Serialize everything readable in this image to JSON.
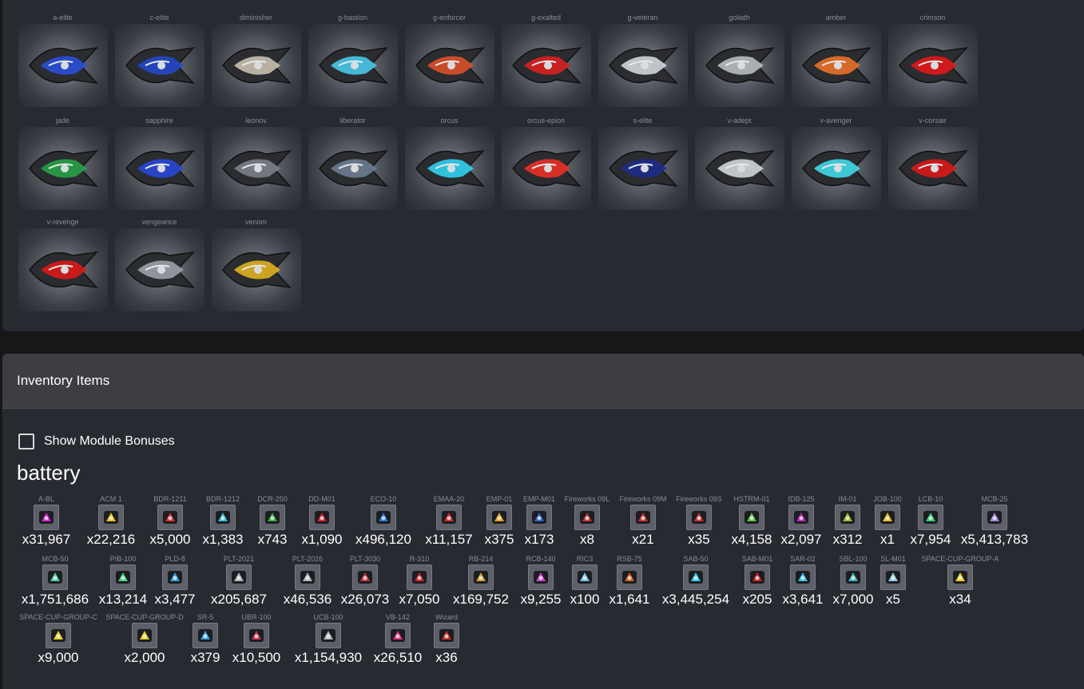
{
  "ships": {
    "rows": [
      [
        {
          "name": "a-elite",
          "color": "#2a4fd8"
        },
        {
          "name": "c-elite",
          "color": "#2248c8"
        },
        {
          "name": "diminisher",
          "color": "#c8c0b0"
        },
        {
          "name": "g-bastion",
          "color": "#47c8e8"
        },
        {
          "name": "g-enforcer",
          "color": "#d8502a"
        },
        {
          "name": "g-exalted",
          "color": "#d82020"
        },
        {
          "name": "g-veteran",
          "color": "#d0d4d8"
        },
        {
          "name": "goliath",
          "color": "#b8bcc0"
        },
        {
          "name": "amber",
          "color": "#e8702a"
        },
        {
          "name": "crimson",
          "color": "#e01818"
        }
      ],
      [
        {
          "name": "jade",
          "color": "#28a048"
        },
        {
          "name": "sapphire",
          "color": "#2848d8"
        },
        {
          "name": "leonov",
          "color": "#7c8088"
        },
        {
          "name": "liberator",
          "color": "#6c7c90"
        },
        {
          "name": "orcus",
          "color": "#30d0f0"
        },
        {
          "name": "orcus-epion",
          "color": "#e83028"
        },
        {
          "name": "s-elite",
          "color": "#1c2c88"
        },
        {
          "name": "v-adept",
          "color": "#d0d4d8"
        },
        {
          "name": "v-avenger",
          "color": "#40d8e8"
        },
        {
          "name": "v-corsair",
          "color": "#d81818"
        }
      ],
      [
        {
          "name": "v-revenge",
          "color": "#d81818"
        },
        {
          "name": "vengeance",
          "color": "#9ca0a8"
        },
        {
          "name": "venom",
          "color": "#e0b020"
        }
      ]
    ]
  },
  "inventory": {
    "title": "Inventory Items",
    "show_bonuses_label": "Show Module Bonuses",
    "category": "battery",
    "rows": [
      [
        {
          "label": "A-BL",
          "count": "x31,967",
          "color": "#d820d8",
          "w": 78
        },
        {
          "label": "ACM 1",
          "count": "x22,216",
          "color": "#e8c020",
          "w": 80
        },
        {
          "label": "BDR-1211",
          "count": "x5,000",
          "color": "#d83030",
          "w": 64
        },
        {
          "label": "BDR-1212",
          "count": "x1,383",
          "color": "#30c0d8",
          "w": 64
        },
        {
          "label": "DCR-250",
          "count": "x743",
          "color": "#30b040",
          "w": 56
        },
        {
          "label": "DD-M01",
          "count": "x1,090",
          "color": "#d82030",
          "w": 64
        },
        {
          "label": "ECO-10",
          "count": "x496,120",
          "color": "#2878d8",
          "w": 86
        },
        {
          "label": "EMAA-20",
          "count": "x11,157",
          "color": "#d82828",
          "w": 74
        },
        {
          "label": "EMP-01",
          "count": "x375",
          "color": "#e8a020",
          "w": 48
        },
        {
          "label": "EMP-M01",
          "count": "x173",
          "color": "#3060d8",
          "w": 48
        },
        {
          "label": "Fireworks 09L",
          "count": "x8",
          "color": "#d03030",
          "w": 68
        },
        {
          "label": "Fireworks 09M",
          "count": "x21",
          "color": "#d03030",
          "w": 68
        },
        {
          "label": "Fireworks 09S",
          "count": "x35",
          "color": "#d03030",
          "w": 68
        },
        {
          "label": "HSTRM-01",
          "count": "x4,158",
          "color": "#60c040",
          "w": 60
        },
        {
          "label": "IDB-125",
          "count": "x2,097",
          "color": "#c020c0",
          "w": 60
        },
        {
          "label": "IM-01",
          "count": "x312",
          "color": "#8ac020",
          "w": 52
        },
        {
          "label": "JOB-100",
          "count": "x1",
          "color": "#e8c020",
          "w": 44
        },
        {
          "label": "LCB-10",
          "count": "x7,954",
          "color": "#30d070",
          "w": 60
        },
        {
          "label": "MCB-25",
          "count": "x5,413,783",
          "color": "#a080e8",
          "w": 96
        }
      ],
      [
        {
          "label": "MCB-50",
          "count": "x1,751,686",
          "color": "#40d0a0",
          "w": 100
        },
        {
          "label": "PIB-100",
          "count": "x13,214",
          "color": "#40d080",
          "w": 66
        },
        {
          "label": "PLD-8",
          "count": "x3,477",
          "color": "#30a0e8",
          "w": 60
        },
        {
          "label": "PLT-2021",
          "count": "x205,687",
          "color": "#b0b4b8",
          "w": 96
        },
        {
          "label": "PLT-2026",
          "count": "x46,536",
          "color": "#b0b4b8",
          "w": 72
        },
        {
          "label": "PLT-3030",
          "count": "x26,073",
          "color": "#d83040",
          "w": 68
        },
        {
          "label": "R-310",
          "count": "x7,050",
          "color": "#d82020",
          "w": 64
        },
        {
          "label": "RB-214",
          "count": "x169,752",
          "color": "#d0a030",
          "w": 86
        },
        {
          "label": "RCB-140",
          "count": "x9,255",
          "color": "#d040d8",
          "w": 60
        },
        {
          "label": "RIC3",
          "count": "x100",
          "color": "#70c8e8",
          "w": 46
        },
        {
          "label": "RSB-75",
          "count": "x1,641",
          "color": "#d06020",
          "w": 62
        },
        {
          "label": "SAB-50",
          "count": "x3,445,254",
          "color": "#30d0f0",
          "w": 100
        },
        {
          "label": "SAB-M01",
          "count": "x205",
          "color": "#d82020",
          "w": 50
        },
        {
          "label": "SAR-02",
          "count": "x3,641",
          "color": "#30c0e8",
          "w": 60
        },
        {
          "label": "SBL-100",
          "count": "x7,000",
          "color": "#40b8c8",
          "w": 62
        },
        {
          "label": "SL-M01",
          "count": "x5",
          "color": "#90c8e8",
          "w": 34
        },
        {
          "label": "SPACE-CUP-GROUP-A",
          "count": "x34",
          "color": "#e8d020",
          "w": 130
        }
      ],
      [
        {
          "label": "SPACE-CUP-GROUP-C",
          "count": "x9,000",
          "color": "#e8d020",
          "w": 108
        },
        {
          "label": "SPACE-CUP-GROUP-D",
          "count": "x2,000",
          "color": "#e8d020",
          "w": 104
        },
        {
          "label": "SR-5",
          "count": "x379",
          "color": "#30a0e8",
          "w": 44
        },
        {
          "label": "UBR-100",
          "count": "x10,500",
          "color": "#d83050",
          "w": 80
        },
        {
          "label": "UCB-100",
          "count": "x1,154,930",
          "color": "#b0b4b8",
          "w": 96
        },
        {
          "label": "VB-142",
          "count": "x26,510",
          "color": "#e83080",
          "w": 74
        },
        {
          "label": "Wizard",
          "count": "x36",
          "color": "#d03020",
          "w": 44
        }
      ]
    ]
  }
}
